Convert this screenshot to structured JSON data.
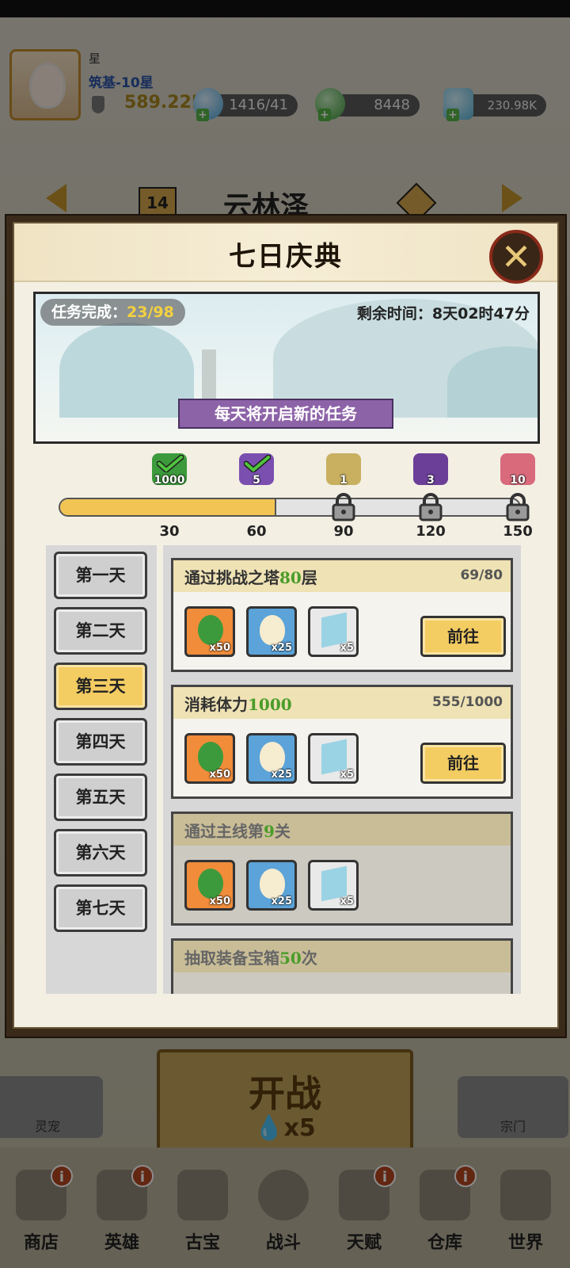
{
  "player": {
    "name": "星",
    "rank": "筑基-10星",
    "power": "589.22K"
  },
  "resources": {
    "energy": "1416/41",
    "money": "8448",
    "crystal": "230.98K"
  },
  "stage": {
    "number": "14",
    "name": "云林泽"
  },
  "modal": {
    "title": "七日庆典",
    "task_label": "任务完成：",
    "task_value": "23/98",
    "remaining": "剩余时间：8天02时47分",
    "note": "每天将开启新的任务",
    "progress_fraction": 0.47,
    "milestones": [
      {
        "value": "30",
        "reward_qty": "1000",
        "claimed": true,
        "reward_icon": "money-bag-icon"
      },
      {
        "value": "60",
        "reward_qty": "5",
        "claimed": true,
        "reward_icon": "purple-crystal-icon"
      },
      {
        "value": "90",
        "reward_qty": "1",
        "claimed": false,
        "reward_icon": "robe-icon"
      },
      {
        "value": "120",
        "reward_qty": "3",
        "claimed": false,
        "reward_icon": "purple-chest-icon"
      },
      {
        "value": "150",
        "reward_qty": "10",
        "claimed": false,
        "reward_icon": "pink-orb-icon"
      }
    ],
    "days": [
      "第一天",
      "第二天",
      "第三天",
      "第四天",
      "第五天",
      "第六天",
      "第七天"
    ],
    "active_day": 2,
    "tasks": [
      {
        "title_pre": "通过挑战之塔",
        "title_num": "80",
        "title_post": "层",
        "progress": "69/80",
        "go": "前往",
        "rewards": [
          "x50",
          "x25",
          "x5"
        ]
      },
      {
        "title_pre": "消耗体力",
        "title_num": "1000",
        "title_post": "",
        "progress": "555/1000",
        "go": "前往",
        "rewards": [
          "x50",
          "x25",
          "x5"
        ]
      },
      {
        "title_pre": "通过主线第",
        "title_num": "9",
        "title_post": "关",
        "progress": "",
        "go": "",
        "rewards": [
          "x50",
          "x25",
          "x5"
        ]
      },
      {
        "title_pre": "抽取装备宝箱",
        "title_num": "50",
        "title_post": "次",
        "progress": "",
        "go": "",
        "rewards": []
      }
    ]
  },
  "bottom": {
    "pet": "灵宠",
    "fight": "开战",
    "fight_cost": "x5",
    "sect": "宗门",
    "nav": [
      "商店",
      "英雄",
      "古宝",
      "战斗",
      "天赋",
      "仓库",
      "世界"
    ]
  },
  "colors": {
    "accent": "#f3cc62",
    "progress": "#f1c453",
    "highlight_num": "#4a9c2a",
    "note_bg": "#8d63a8"
  }
}
